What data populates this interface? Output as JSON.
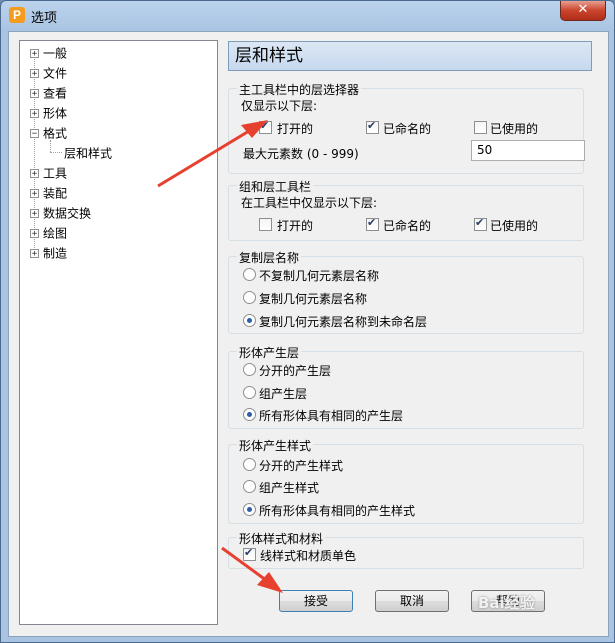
{
  "window": {
    "title": "选项",
    "app_icon_letter": "P",
    "close_glyph": "✕"
  },
  "tree": {
    "items": [
      {
        "label": "一般",
        "expander": "+"
      },
      {
        "label": "文件",
        "expander": "+"
      },
      {
        "label": "查看",
        "expander": "+"
      },
      {
        "label": "形体",
        "expander": "+"
      },
      {
        "label": "格式",
        "expander": "−"
      },
      {
        "label": "层和样式",
        "expander": ""
      },
      {
        "label": "工具",
        "expander": "+"
      },
      {
        "label": "装配",
        "expander": "+"
      },
      {
        "label": "数据交换",
        "expander": "+"
      },
      {
        "label": "绘图",
        "expander": "+"
      },
      {
        "label": "制造",
        "expander": "+"
      }
    ]
  },
  "panel": {
    "title": "层和样式"
  },
  "main_toolbar_group": {
    "title": "主工具栏中的层选择器",
    "subtitle": "仅显示以下层:",
    "options": [
      {
        "label": "打开的",
        "checked": true
      },
      {
        "label": "已命名的",
        "checked": true
      },
      {
        "label": "已使用的",
        "checked": false
      }
    ],
    "max_elements_label": "最大元素数 (0 - 999)",
    "max_elements_value": "50"
  },
  "group_toolbar_group": {
    "title": "组和层工具栏",
    "subtitle": "在工具栏中仅显示以下层:",
    "options": [
      {
        "label": "打开的",
        "checked": false
      },
      {
        "label": "已命名的",
        "checked": true
      },
      {
        "label": "已使用的",
        "checked": true
      }
    ]
  },
  "copy_layer_group": {
    "title": "复制层名称",
    "options": [
      {
        "label": "不复制几何元素层名称",
        "selected": false
      },
      {
        "label": "复制几何元素层名称",
        "selected": false
      },
      {
        "label": "复制几何元素层名称到未命名层",
        "selected": true
      }
    ]
  },
  "body_layer_group": {
    "title": "形体产生层",
    "options": [
      {
        "label": "分开的产生层",
        "selected": false
      },
      {
        "label": "组产生层",
        "selected": false
      },
      {
        "label": "所有形体具有相同的产生层",
        "selected": true
      }
    ]
  },
  "body_style_group": {
    "title": "形体产生样式",
    "options": [
      {
        "label": "分开的产生样式",
        "selected": false
      },
      {
        "label": "组产生样式",
        "selected": false
      },
      {
        "label": "所有形体具有相同的产生样式",
        "selected": true
      }
    ]
  },
  "material_group": {
    "title": "形体样式和材料",
    "options": [
      {
        "label": "线样式和材质单色",
        "checked": true
      }
    ]
  },
  "buttons": {
    "accept": "接受",
    "cancel": "取消",
    "help": "帮助"
  },
  "watermark": "Bai经验",
  "colors": {
    "annotation_arrow": "#e8402f",
    "header_bg": "#c7d8ee",
    "radio_dot": "#2f5ea8"
  }
}
